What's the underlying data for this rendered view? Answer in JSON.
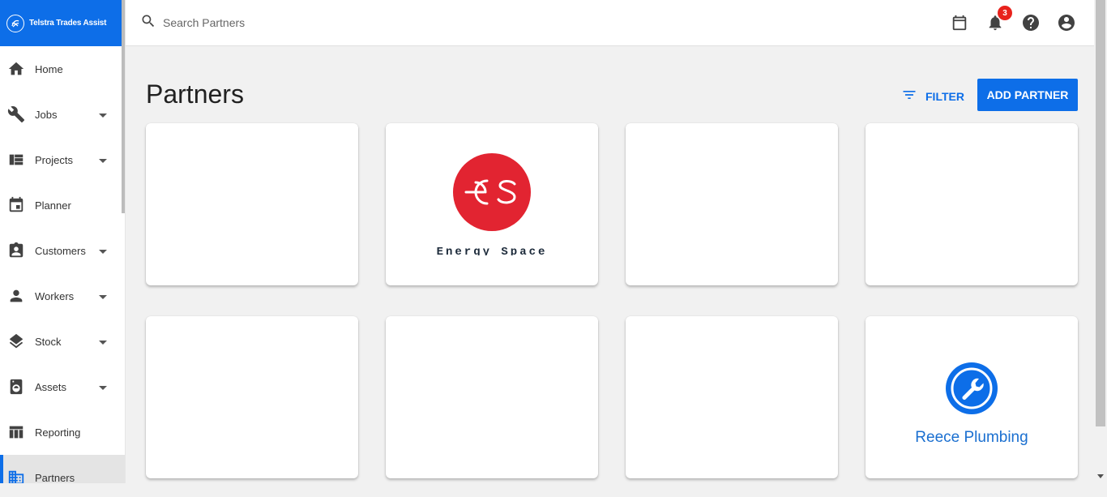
{
  "brand": {
    "name": "Telstra Trades Assist",
    "logo_icon": "telstra-swirl-icon"
  },
  "sidebar": {
    "items": [
      {
        "label": "Home",
        "icon": "home-icon",
        "expandable": false
      },
      {
        "label": "Jobs",
        "icon": "wrench-icon",
        "expandable": true
      },
      {
        "label": "Projects",
        "icon": "view-quilt-icon",
        "expandable": true
      },
      {
        "label": "Planner",
        "icon": "calendar-event-icon",
        "expandable": false
      },
      {
        "label": "Customers",
        "icon": "contact-card-icon",
        "expandable": true
      },
      {
        "label": "Workers",
        "icon": "person-icon",
        "expandable": true
      },
      {
        "label": "Stock",
        "icon": "layers-icon",
        "expandable": true
      },
      {
        "label": "Assets",
        "icon": "washer-icon",
        "expandable": true
      },
      {
        "label": "Reporting",
        "icon": "table-icon",
        "expandable": false
      },
      {
        "label": "Partners",
        "icon": "building-icon",
        "expandable": false,
        "active": true
      }
    ]
  },
  "search": {
    "placeholder": "Search Partners",
    "value": ""
  },
  "topbar": {
    "icons": [
      "calendar-icon",
      "bell-icon",
      "help-icon",
      "account-icon"
    ],
    "notification_count": "3"
  },
  "page": {
    "title": "Partners",
    "filter_label": "FILTER",
    "add_label": "ADD PARTNER"
  },
  "partners": [
    {
      "name": "",
      "logo": ""
    },
    {
      "name": "Energy Space",
      "logo_text": "es",
      "logo": "energy-space-logo"
    },
    {
      "name": "",
      "logo": ""
    },
    {
      "name": "",
      "logo": ""
    },
    {
      "name": "",
      "logo": ""
    },
    {
      "name": "",
      "logo": ""
    },
    {
      "name": "",
      "logo": ""
    },
    {
      "name": "Reece Plumbing",
      "logo": "wrench-circle-logo"
    }
  ],
  "colors": {
    "accent": "#0d6ee8",
    "badge": "#e8221c",
    "energy_space_red": "#e22431"
  }
}
